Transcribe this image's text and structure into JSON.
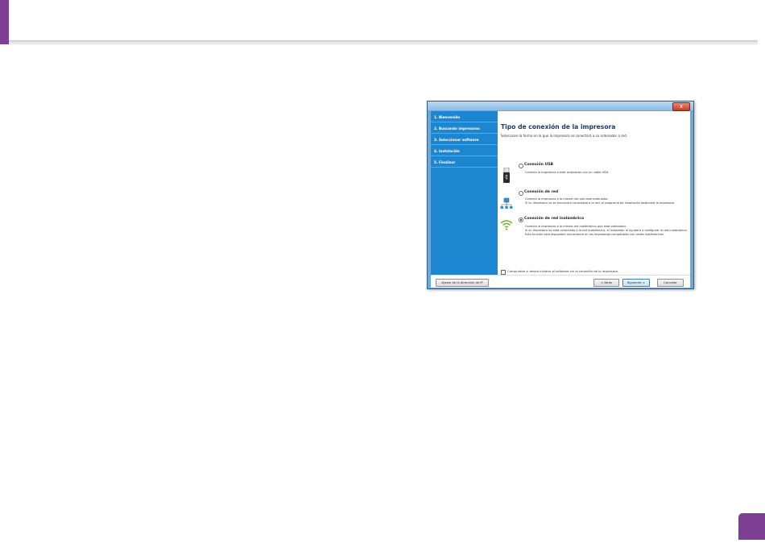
{
  "installer": {
    "title_bar": {
      "close_glyph": "x"
    },
    "steps": [
      {
        "label": "1. Bienvenido"
      },
      {
        "label": "2. Buscando impresoras"
      },
      {
        "label": "3. Seleccionar software"
      },
      {
        "label": "4. Instalación"
      },
      {
        "label": "5. Finalizar"
      }
    ],
    "heading": "Tipo de conexión de la impresora",
    "subheading": "Seleccione la forma en la que la impresora se conectará a su ordenador o red.",
    "options": [
      {
        "label": "Conexión USB",
        "icon": "usb-icon",
        "selected": false,
        "description": "Conecte la impresora a este ordenador con un cable USB."
      },
      {
        "label": "Conexión de red",
        "icon": "network-icon",
        "selected": false,
        "description": "Conecte la impresora a la misma red que este ordenador.\nSi su impresora ya se encuentra conectada a la red, el programa de instalación detectará la impresora."
      },
      {
        "label": "Conexión de red inalámbrica",
        "icon": "wifi-icon",
        "selected": true,
        "description": "Conecte la impresora a la misma red inalámbrica que este ordenador.\nSi su impresora no está conectada a la red inalámbrica, el instalador le ayudará a configurar la red inalámbrica. Esta función está disponible únicamente en las impresoras compatibles con redes inalámbricas."
      }
    ],
    "checkbox_label": "Compruebe si desea instalar el software sin la conexión de la impresora.",
    "checkbox_checked": false,
    "buttons": {
      "ip_setting": "Ajuste de la dirección de IP",
      "back": "< Atrás",
      "next": "Siguiente >",
      "cancel": "Cancelar"
    }
  },
  "colors": {
    "accent": "#7d3f94",
    "sidebar": "#1d86d1",
    "window_frame": "#6ea8d7"
  }
}
